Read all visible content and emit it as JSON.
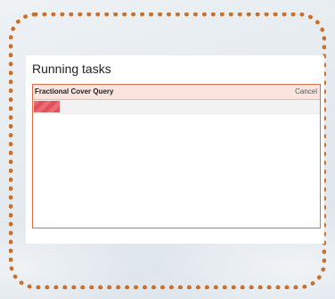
{
  "panel": {
    "title": "Running tasks"
  },
  "tasks": [
    {
      "name": "Fractional Cover Query",
      "cancel_label": "Cancel",
      "progress_fraction": 0.09
    }
  ],
  "colors": {
    "frame_border": "#c8702c",
    "task_border": "#e06a4e",
    "task_header_bg": "#fbe4de",
    "progress_fill": "#e2505a"
  }
}
